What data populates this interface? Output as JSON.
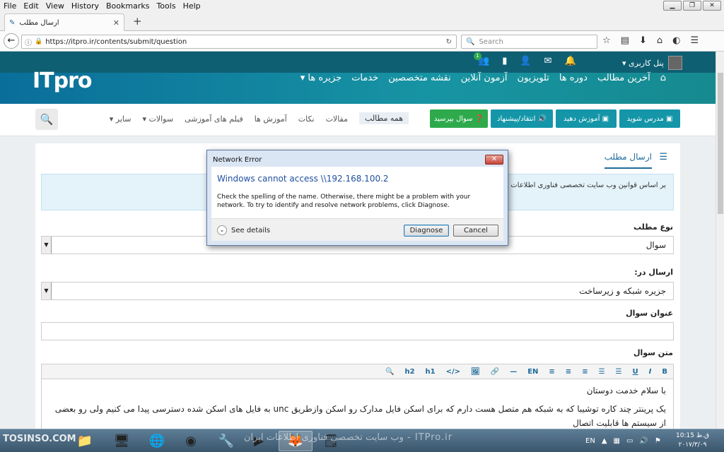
{
  "menubar": {
    "items": [
      "File",
      "Edit",
      "View",
      "History",
      "Bookmarks",
      "Tools",
      "Help"
    ]
  },
  "tab": {
    "title": "ارسال مطلب"
  },
  "navbar": {
    "url": "https://itpro.ir/contents/submit/question",
    "search_placeholder": "Search"
  },
  "site": {
    "logo": "ITpro",
    "main_nav": [
      "آخرین مطالب",
      "دوره ها",
      "تلویزیون",
      "آزمون آنلاین",
      "نقشه متخصصین",
      "خدمات",
      "جزیره ها ▾"
    ],
    "user_panel": "پنل کاربری ▾",
    "badge_count": "1"
  },
  "subnav": {
    "buttons": [
      {
        "label": "مدرس شوید",
        "color": "#1496a8"
      },
      {
        "label": "آموزش دهید",
        "color": "#1496a8"
      },
      {
        "label": "انتقاد/پیشنهاد",
        "color": "#1496a8"
      },
      {
        "label": "سوال بپرسید",
        "color": "#2eaa4c"
      }
    ],
    "links": [
      "همه مطالب",
      "مقالات",
      "نکات",
      "آموزش ها",
      "فیلم های آموزشی",
      "سوالات ▾",
      "سایر ▾"
    ]
  },
  "card": {
    "title": "ارسال مطلب",
    "notice": "بر اساس قوانین وب سایت تخصصی فناوری اطلاعات ... نوع بوده و مطالب ذکر شده بدون هر گونه اطلاع قبلی از وب سایت حذف خواهند شد.",
    "type_label": "نوع مطلب",
    "type_value": "سوال",
    "send_in_label": "ارسال در:",
    "send_in_value": "جزیره شبکه و زیرساخت",
    "question_title_label": "عنوان سوال",
    "question_text_label": "متن سوال",
    "editor_toolbar": [
      "🔍",
      "h2",
      "h1",
      "</>",
      "🖼",
      "🔗",
      "—",
      "EN",
      "≡",
      "≡",
      "≡",
      "☰",
      "☰",
      "U",
      "I",
      "B"
    ],
    "body_line1": "با سلام خدمت دوستان",
    "body_line2": "یک پرینتر چند کاره توشیبا که به شبکه هم متصل هست دارم که برای اسکن فایل مدارک رو اسکن وازطریق unc  به فایل های اسکن شده دسترسی پیدا می کنیم ولی رو بعضی از سیستم ها قابلیت اتصال"
  },
  "dialog": {
    "title": "Network Error",
    "main": "Windows cannot access \\\\192.168.100.2",
    "text": "Check the spelling of the name. Otherwise, there might be a problem with your network. To try to identify and resolve network problems, click Diagnose.",
    "see_details": "See details",
    "diagnose": "Diagnose",
    "cancel": "Cancel"
  },
  "taskbar": {
    "tosinso": "TOSINSO.COM",
    "watermark": "ITPro.ir - وب سایت تخصصی فناوری اطلاعات ایران",
    "lang": "EN",
    "time": "10:15 ق.ظ",
    "date": "۲۰۱۷/۳/۰۹"
  }
}
